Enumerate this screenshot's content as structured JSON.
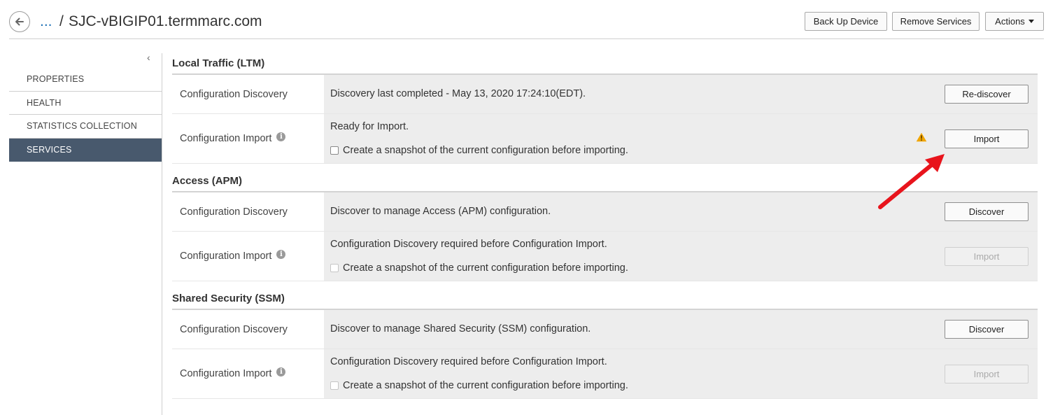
{
  "header": {
    "breadcrumb_ellipsis": "...",
    "breadcrumb_sep": "/",
    "title": "SJC-vBIGIP01.termmarc.com",
    "buttons": {
      "backup": "Back Up Device",
      "remove": "Remove Services",
      "actions": "Actions"
    }
  },
  "sidebar": {
    "collapse_glyph": "‹",
    "items": [
      {
        "label": "PROPERTIES",
        "active": false
      },
      {
        "label": "HEALTH",
        "active": false
      },
      {
        "label": "STATISTICS COLLECTION",
        "active": false
      },
      {
        "label": "SERVICES",
        "active": true
      }
    ]
  },
  "sections": [
    {
      "title": "Local Traffic (LTM)",
      "discovery": {
        "label": "Configuration Discovery",
        "text": "Discovery last completed - May 13, 2020 17:24:10(EDT).",
        "button": "Re-discover"
      },
      "import": {
        "label": "Configuration Import",
        "text": "Ready for Import.",
        "snapshot": "Create a snapshot of the current configuration before importing.",
        "button": "Import",
        "button_enabled": true,
        "warning": true
      }
    },
    {
      "title": "Access (APM)",
      "discovery": {
        "label": "Configuration Discovery",
        "text": "Discover to manage Access (APM) configuration.",
        "button": "Discover"
      },
      "import": {
        "label": "Configuration Import",
        "text": "Configuration Discovery required before Configuration Import.",
        "snapshot": "Create a snapshot of the current configuration before importing.",
        "button": "Import",
        "button_enabled": false,
        "warning": false
      }
    },
    {
      "title": "Shared Security (SSM)",
      "discovery": {
        "label": "Configuration Discovery",
        "text": "Discover to manage Shared Security (SSM) configuration.",
        "button": "Discover"
      },
      "import": {
        "label": "Configuration Import",
        "text": "Configuration Discovery required before Configuration Import.",
        "snapshot": "Create a snapshot of the current configuration before importing.",
        "button": "Import",
        "button_enabled": false,
        "warning": false
      }
    }
  ],
  "colors": {
    "active_nav": "#48596d",
    "link": "#1a6fb5",
    "warning": "#f0a500",
    "annotation_arrow": "#e8141c"
  },
  "icons": {
    "back": "back-arrow-icon",
    "info": "info-icon",
    "warning": "warning-icon"
  }
}
